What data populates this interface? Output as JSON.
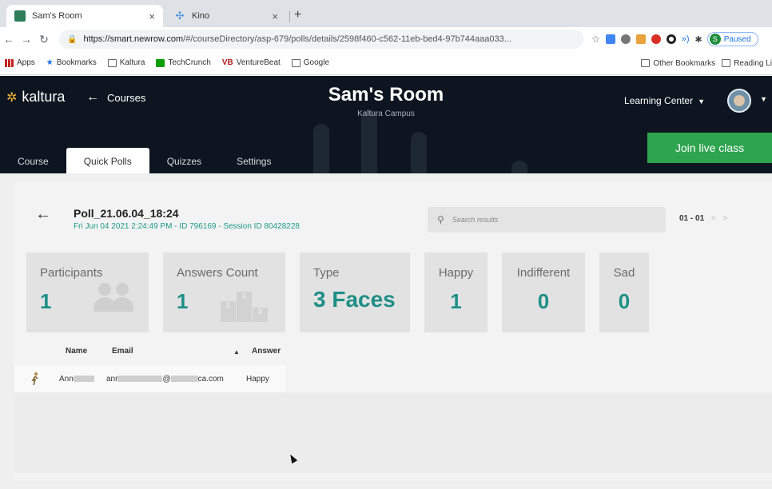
{
  "browser": {
    "tabs": [
      {
        "title": "Sam's Room",
        "close": "×"
      },
      {
        "title": "Kino",
        "close": "×"
      }
    ],
    "new_tab": "+",
    "url_host": "https://smart.newrow.com",
    "url_path": "/#/courseDirectory/asp-679/polls/details/2598f460-c562-11eb-bed4-97b744aaa033...",
    "profile_label": "Paused",
    "profile_initial": "S",
    "bookmarks": [
      "Apps",
      "Bookmarks",
      "Kaltura",
      "TechCrunch",
      "VentureBeat",
      "Google"
    ],
    "other_bookmarks": "Other Bookmarks",
    "reading_list": "Reading Li"
  },
  "header": {
    "logo_text": "kaltura",
    "back_label": "Courses",
    "room_title": "Sam's Room",
    "room_subtitle": "Kaltura Campus",
    "learning_center": "Learning Center",
    "join_label": "Join live class",
    "tabs": [
      "Course",
      "Quick Polls",
      "Quizzes",
      "Settings"
    ]
  },
  "poll": {
    "name": "Poll_21.06.04_18:24",
    "meta": "Fri Jun 04 2021 2:24:49 PM - ID 796169 - Session ID 80428228",
    "search_placeholder": "Search results",
    "pager": "01 - 01",
    "pager_prev": "<",
    "pager_next": ">"
  },
  "stats": {
    "participants": {
      "label": "Participants",
      "value": "1"
    },
    "answers": {
      "label": "Answers Count",
      "value": "1",
      "podium": [
        "2",
        "1",
        "3"
      ]
    },
    "type": {
      "label": "Type",
      "value": "3 Faces"
    },
    "happy": {
      "label": "Happy",
      "value": "1"
    },
    "indifferent": {
      "label": "Indifferent",
      "value": "0"
    },
    "sad": {
      "label": "Sad",
      "value": "0"
    }
  },
  "table": {
    "headers": {
      "name": "Name",
      "email": "Email",
      "sort": "▲",
      "answer": "Answer"
    },
    "rows": [
      {
        "name": "Ann",
        "email_prefix": "anr",
        "email_at": "@",
        "email_domain": "ca.com",
        "answer": "Happy"
      }
    ]
  },
  "colors": {
    "header_bg": "#0d1620",
    "join_green": "#2ea44f",
    "stat_teal": "#1e8f87",
    "meta_teal": "#1e9a8a"
  }
}
